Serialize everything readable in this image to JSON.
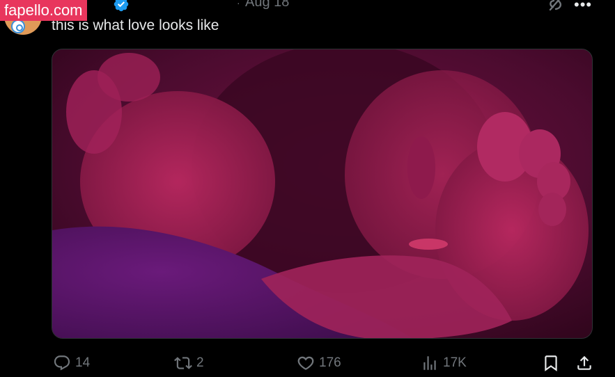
{
  "watermark": "fapello.com",
  "tweet": {
    "date": "Aug 18",
    "text": "this is what love looks like",
    "more_label": "•••"
  },
  "actions": {
    "replies": "14",
    "reposts": "2",
    "likes": "176",
    "views": "17K"
  },
  "colors": {
    "background": "#000000",
    "text": "#e7e9ea",
    "muted": "#71767b",
    "verified": "#1d9bf0",
    "watermark": "#e8365d"
  },
  "icons": {
    "verified": "verified-badge-icon",
    "grok": "grok-icon",
    "more": "more-icon",
    "reply": "reply-icon",
    "repost": "repost-icon",
    "like": "heart-icon",
    "views": "views-icon",
    "bookmark": "bookmark-icon",
    "share": "share-icon"
  }
}
